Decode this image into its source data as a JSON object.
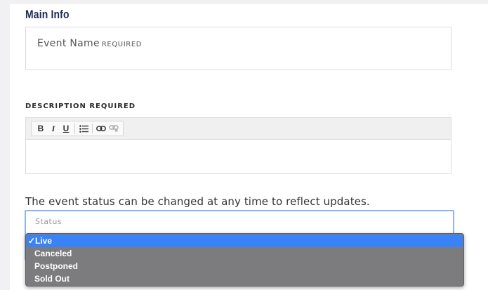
{
  "main_info": {
    "title": "Main Info",
    "event_name_label": "Event Name",
    "event_name_required": "REQUIRED"
  },
  "description": {
    "label": "DESCRIPTION REQUIRED",
    "toolbar": {
      "bold": "B",
      "italic": "I",
      "underline": "U"
    }
  },
  "status": {
    "help_text": "The event status can be changed at any time to reflect updates.",
    "select_label": "Status",
    "options": [
      "Live",
      "Canceled",
      "Postponed",
      "Sold Out"
    ],
    "selected": "Live",
    "check_mark": "✓"
  },
  "colors": {
    "title": "#1b2b58",
    "selected_option": "#3a82f7",
    "dropdown_bg": "#7c7c7e",
    "focus_border": "#8fb5f0"
  }
}
